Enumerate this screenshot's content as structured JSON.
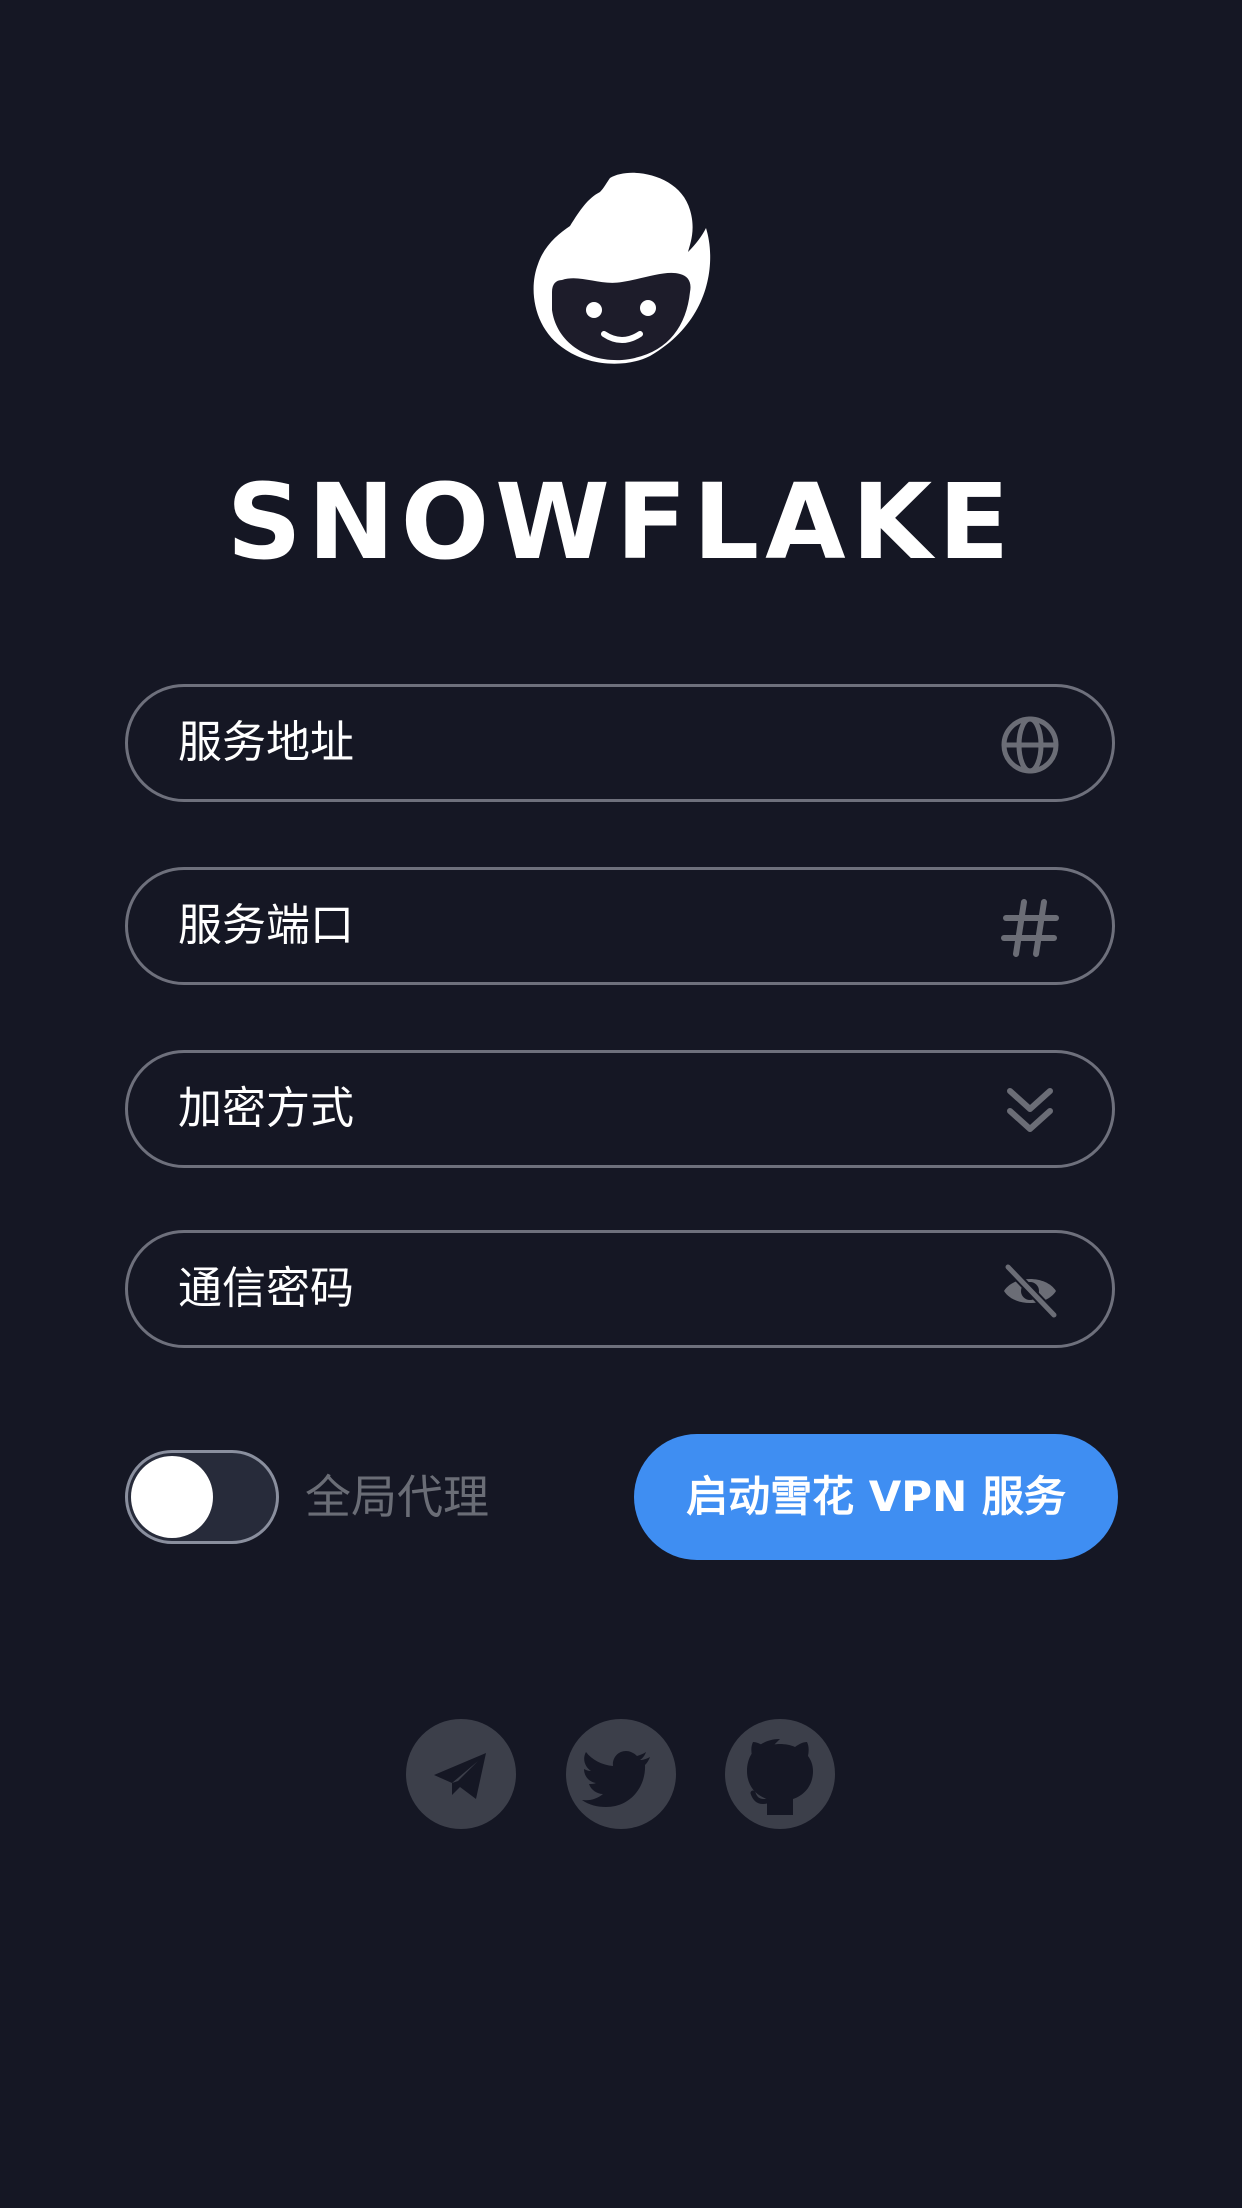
{
  "app": {
    "brand": "SNOWFLAKE"
  },
  "form": {
    "server_address": {
      "label": "服务地址",
      "icon": "globe-icon"
    },
    "server_port": {
      "label": "服务端口",
      "icon": "hash-icon"
    },
    "encryption": {
      "label": "加密方式",
      "icon": "double-chevron-down-icon"
    },
    "password": {
      "label": "通信密码",
      "icon": "eye-off-icon"
    }
  },
  "global_proxy": {
    "label": "全局代理",
    "enabled": false
  },
  "start_button": {
    "label": "启动雪花 VPN 服务"
  },
  "social": [
    {
      "name": "telegram-icon"
    },
    {
      "name": "twitter-icon"
    },
    {
      "name": "github-icon"
    }
  ],
  "colors": {
    "background": "#151724",
    "accent": "#3f8ef2",
    "field_border": "#6e707c",
    "icon_gray": "#6b6d76"
  }
}
